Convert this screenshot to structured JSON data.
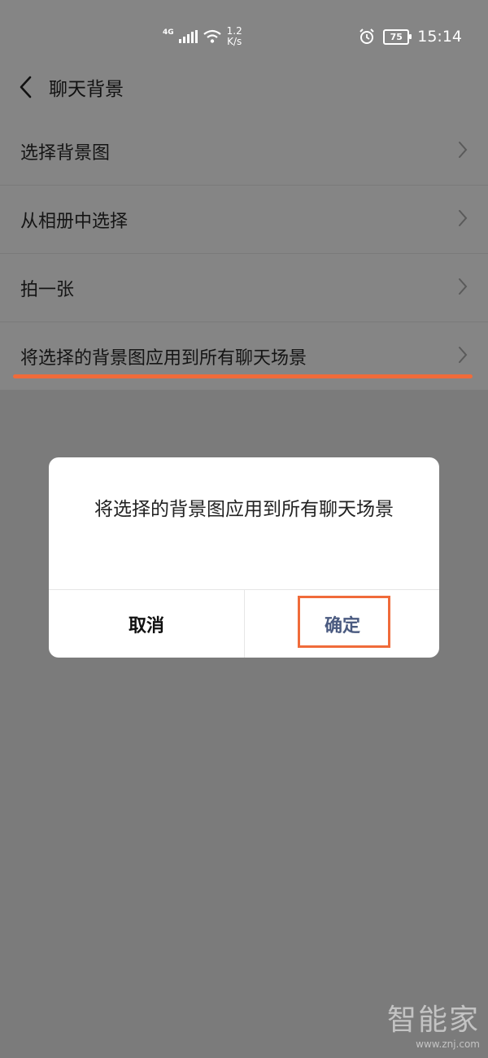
{
  "status_bar": {
    "network": "4G",
    "speed_value": "1.2",
    "speed_unit": "K/s",
    "battery": "75",
    "time": "15:14"
  },
  "header": {
    "title": "聊天背景"
  },
  "list": {
    "items": [
      {
        "label": "选择背景图"
      },
      {
        "label": "从相册中选择"
      },
      {
        "label": "拍一张"
      },
      {
        "label": "将选择的背景图应用到所有聊天场景"
      }
    ]
  },
  "dialog": {
    "message": "将选择的背景图应用到所有聊天场景",
    "cancel_label": "取消",
    "confirm_label": "确定"
  },
  "watermark": {
    "title": "智能家",
    "url": "www.znj.com"
  },
  "colors": {
    "highlight": "#f06b3a",
    "confirm_text": "#4a5a80",
    "overlay_bg": "#7b7b7b"
  }
}
